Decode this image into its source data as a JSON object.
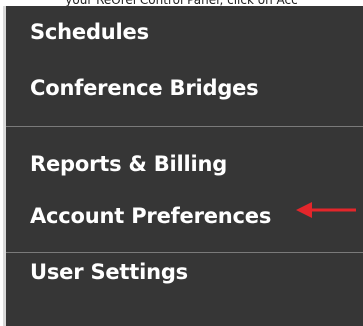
{
  "caption": {
    "text": "your ReOrel Control Panel, click on Acc"
  },
  "menu": {
    "items": [
      {
        "label": "Schedules"
      },
      {
        "label": "Conference Bridges"
      },
      {
        "label": "Reports & Billing"
      },
      {
        "label": "Account Preferences"
      },
      {
        "label": "User Settings"
      }
    ]
  },
  "annotation": {
    "arrow_icon": "arrow-left-icon",
    "arrow_color": "#e3262b"
  },
  "colors": {
    "menu_background": "#363636",
    "menu_text": "#ffffff",
    "divider": "#7a7a7a"
  }
}
